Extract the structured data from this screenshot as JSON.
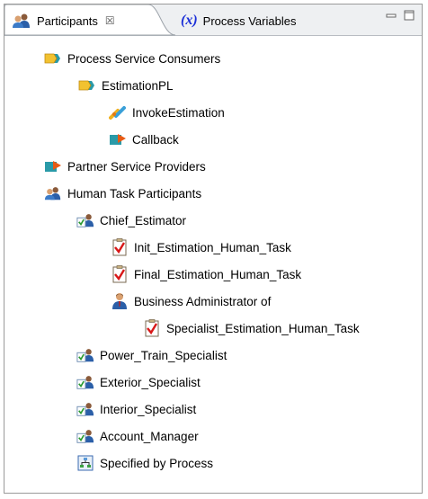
{
  "tabs": {
    "participants": {
      "label": "Participants",
      "close": "☒"
    },
    "process_variables": {
      "label": "Process Variables",
      "icon_text": "(x)"
    }
  },
  "window_controls": [
    "minimize-icon",
    "maximize-icon"
  ],
  "tree": {
    "process_service_consumers": {
      "label": "Process Service Consumers",
      "icon": "service-consumer-icon"
    },
    "estimationpl": {
      "label": "EstimationPL",
      "icon": "service-consumer-icon"
    },
    "invoke_estimation": {
      "label": "InvokeEstimation",
      "icon": "invoke-icon"
    },
    "callback": {
      "label": "Callback",
      "icon": "callback-icon"
    },
    "partner_service_providers": {
      "label": "Partner Service Providers",
      "icon": "service-provider-icon"
    },
    "human_task_participants": {
      "label": "Human Task Participants",
      "icon": "people-icon"
    },
    "chief_estimator": {
      "label": "Chief_Estimator",
      "icon": "role-icon"
    },
    "init_estimation": {
      "label": "Init_Estimation_Human_Task",
      "icon": "human-task-icon"
    },
    "final_estimation": {
      "label": "Final_Estimation_Human_Task",
      "icon": "human-task-icon"
    },
    "business_admin": {
      "label": "Business Administrator of",
      "icon": "admin-person-icon"
    },
    "specialist_estimation": {
      "label": "Specialist_Estimation_Human_Task",
      "icon": "human-task-icon"
    },
    "power_train": {
      "label": "Power_Train_Specialist",
      "icon": "role-icon"
    },
    "exterior": {
      "label": "Exterior_Specialist",
      "icon": "role-icon"
    },
    "interior": {
      "label": "Interior_Specialist",
      "icon": "role-icon"
    },
    "account_manager": {
      "label": "Account_Manager",
      "icon": "role-icon"
    },
    "specified_by_process": {
      "label": "Specified by Process",
      "icon": "process-icon"
    }
  }
}
